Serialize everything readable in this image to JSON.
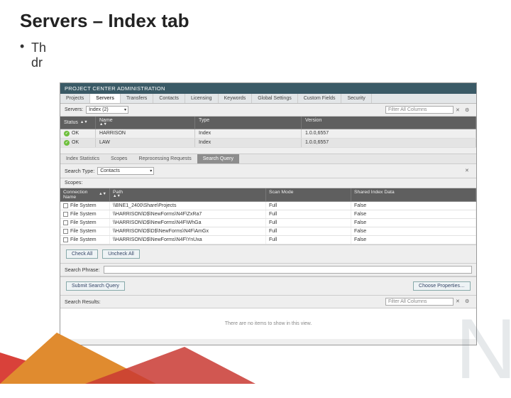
{
  "slide": {
    "title": "Servers – Index tab",
    "bullet1_a": "Th",
    "bullet1_b": "dr"
  },
  "app": {
    "titlebar": "PROJECT CENTER ADMINISTRATION",
    "tabs": [
      "Projects",
      "Servers",
      "Transfers",
      "Contacts",
      "Licensing",
      "Keywords",
      "Global Settings",
      "Custom Fields",
      "Security"
    ],
    "active_tab_index": 1,
    "subbar": {
      "label": "Servers:",
      "select_value": "Index (2)"
    },
    "filter_placeholder": "Filter All Columns"
  },
  "servers_grid": {
    "headers": [
      "Status",
      "Name",
      "Type",
      "Version"
    ],
    "rows": [
      {
        "status": "OK",
        "name": "HARRISON",
        "type": "Index",
        "version": "1.0.0,6557"
      },
      {
        "status": "OK",
        "name": "LAW",
        "type": "Index",
        "version": "1.0.0,6557"
      }
    ]
  },
  "detail_tabs": {
    "tabs": [
      "Index Statistics",
      "Scopes",
      "Reprocessing Requests",
      "Search Query"
    ],
    "active_index": 3
  },
  "search_query": {
    "search_type_label": "Search Type:",
    "search_type_value": "Contacts",
    "scopes_label": "Scopes:",
    "scope_headers": [
      "Connection Name",
      "Path",
      "Scan Mode",
      "Shared Index Data"
    ],
    "scopes": [
      {
        "cn": "File System",
        "path": "\\\\BNE1_2400\\Share\\Projects",
        "scan": "Full",
        "shared": "False"
      },
      {
        "cn": "File System",
        "path": "\\\\HARRISON\\D$\\NewForms\\N4F\\ZxRa7",
        "scan": "Full",
        "shared": "False"
      },
      {
        "cn": "File System",
        "path": "\\\\HARRISON\\D$\\NewForms\\N4F\\WhGa",
        "scan": "Full",
        "shared": "False"
      },
      {
        "cn": "File System",
        "path": "\\\\HARRISON\\D$\\D$\\NewForms\\N4F\\AmGx",
        "scan": "Full",
        "shared": "False"
      },
      {
        "cn": "File System",
        "path": "\\\\HARRISON\\D$\\NewForms\\N4F\\YnUxa",
        "scan": "Full",
        "shared": "False"
      }
    ],
    "check_all": "Check All",
    "uncheck_all": "Uncheck All",
    "search_phrase_label": "Search Phrase:",
    "submit_label": "Submit Search Query",
    "choose_props_label": "Choose Properties…",
    "results_label": "Search Results:",
    "results_filter_placeholder": "Filter All Columns",
    "results_empty": "There are no items to show in this view."
  },
  "colors": {
    "header_bg": "#3a5a66",
    "ok_green": "#6fbf3d"
  }
}
